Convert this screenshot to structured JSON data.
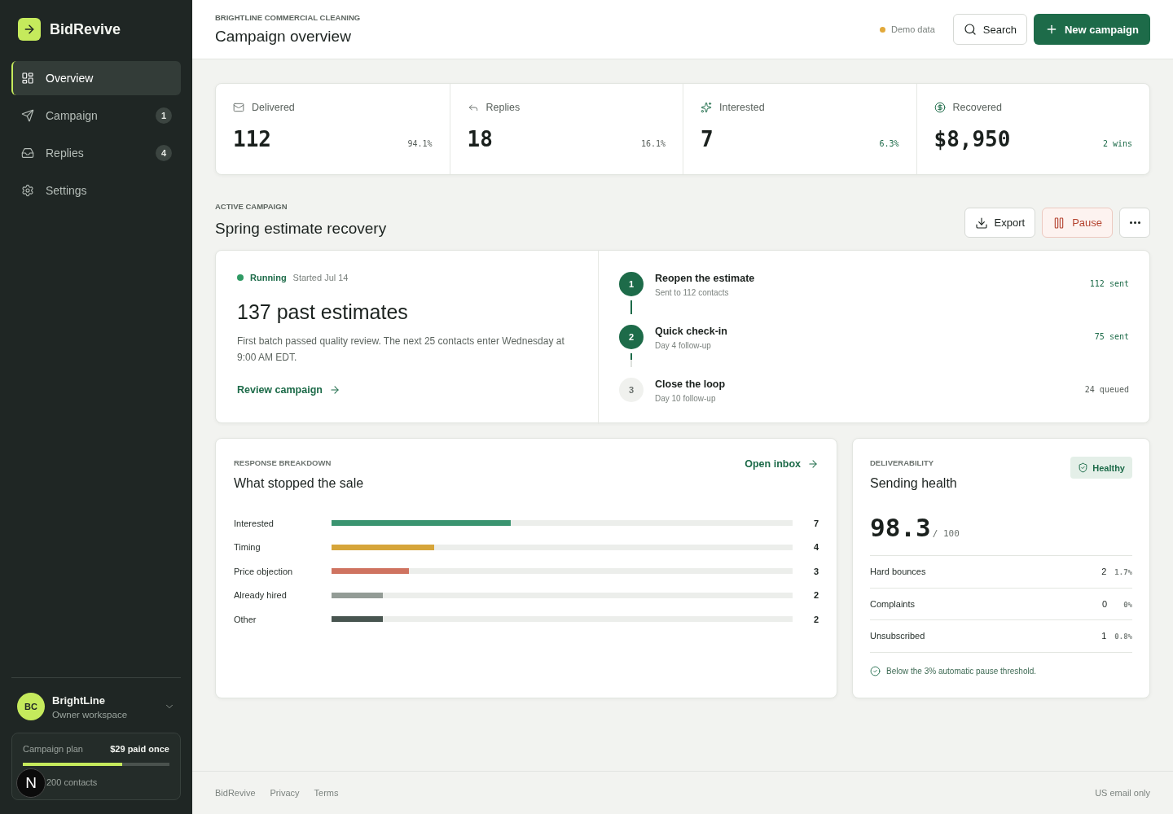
{
  "sidebar": {
    "brand": "BidRevive",
    "nav": [
      {
        "label": "Overview",
        "selected": true
      },
      {
        "label": "Campaign",
        "selected": false,
        "badge": "1"
      },
      {
        "label": "Replies",
        "selected": false,
        "badge": "4"
      },
      {
        "label": "Settings",
        "selected": false
      }
    ],
    "workspace": {
      "initials": "BC",
      "name": "BrightLine",
      "role": "Owner workspace"
    },
    "plan": {
      "label": "Campaign plan",
      "price": "$29 paid once",
      "level": 0.68,
      "contacts": "200 contacts"
    }
  },
  "dev_badge": {
    "label": "N"
  },
  "header": {
    "eyebrow": "BRIGHTLINE COMMERCIAL CLEANING",
    "title": "Campaign overview",
    "demo_label": "Demo data",
    "search_button": "Search",
    "primary_button": "New campaign"
  },
  "stats": [
    {
      "label": "Delivered",
      "value": "112",
      "meta": "94.1%",
      "positive": false
    },
    {
      "label": "Replies",
      "value": "18",
      "meta": "16.1%",
      "positive": false
    },
    {
      "label": "Interested",
      "value": "7",
      "meta": "6.3%",
      "positive": true
    },
    {
      "label": "Recovered",
      "value": "$8,950",
      "meta": "2 wins",
      "positive": true
    }
  ],
  "campaign": {
    "eyebrow": "ACTIVE CAMPAIGN",
    "title": "Spring estimate recovery",
    "export_button": "Export",
    "pause_button": "Pause",
    "status": {
      "kind": "running",
      "label": "Running",
      "started": "Started Jul 14"
    },
    "headline": "137 past estimates",
    "summary": "First batch passed quality review. The next 25 contacts enter Wednesday at 9:00 AM EDT.",
    "link": "Review campaign",
    "steps": [
      {
        "number": "1",
        "title": "Reopen the estimate",
        "detail": "Sent to 112 contacts",
        "count": "112 sent",
        "done": true
      },
      {
        "number": "2",
        "title": "Quick check-in",
        "detail": "Day 4 follow-up",
        "count": "75 sent",
        "done": true
      },
      {
        "number": "3",
        "title": "Close the loop",
        "detail": "Day 10 follow-up",
        "count": "24 queued",
        "done": false
      }
    ]
  },
  "breakdown": {
    "eyebrow": "RESPONSE BREAKDOWN",
    "title": "What stopped the sale",
    "link": "Open inbox",
    "rows": [
      {
        "label": "Interested",
        "value": "7",
        "level": 0.389,
        "color": "#3a9470"
      },
      {
        "label": "Timing",
        "value": "4",
        "level": 0.222,
        "color": "#d6a53a"
      },
      {
        "label": "Price objection",
        "value": "3",
        "level": 0.167,
        "color": "#cf7360"
      },
      {
        "label": "Already hired",
        "value": "2",
        "level": 0.111,
        "color": "#939c96"
      },
      {
        "label": "Other",
        "value": "2",
        "level": 0.111,
        "color": "#485550"
      }
    ]
  },
  "health": {
    "eyebrow": "DELIVERABILITY",
    "title": "Sending health",
    "badge": "Healthy",
    "score": "98.3",
    "scale": "/ 100",
    "metrics": [
      {
        "label": "Hard bounces",
        "count": "2",
        "share": "1.7%"
      },
      {
        "label": "Complaints",
        "count": "0",
        "share": "0%"
      },
      {
        "label": "Unsubscribed",
        "count": "1",
        "share": "0.8%"
      }
    ],
    "note": "Below the 3% automatic pause threshold."
  },
  "footer": {
    "links": [
      "BidRevive",
      "Privacy",
      "Terms"
    ],
    "note": "US email only"
  }
}
